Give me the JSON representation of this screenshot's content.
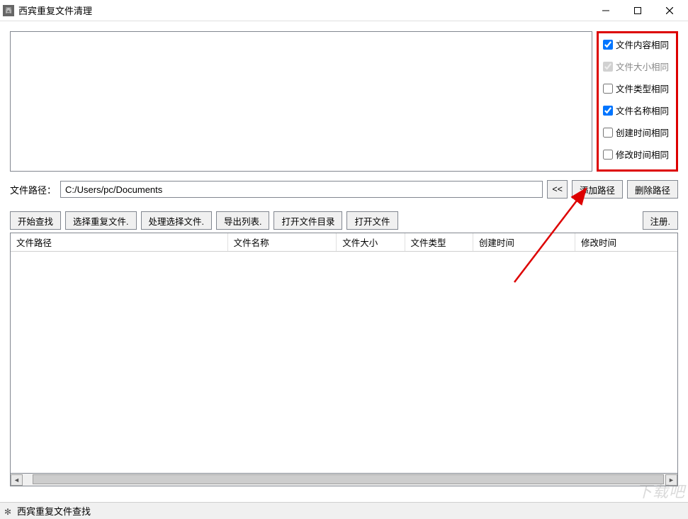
{
  "title": "西宾重复文件清理",
  "filters": [
    {
      "label": "文件内容相同",
      "checked": true,
      "disabled": false
    },
    {
      "label": "文件大小相同",
      "checked": true,
      "disabled": true
    },
    {
      "label": "文件类型相同",
      "checked": false,
      "disabled": false
    },
    {
      "label": "文件名称相同",
      "checked": true,
      "disabled": false
    },
    {
      "label": "创建时间相同",
      "checked": false,
      "disabled": false
    },
    {
      "label": "修改时间相同",
      "checked": false,
      "disabled": false
    }
  ],
  "path_row": {
    "label": "文件路径：",
    "value": "C:/Users/pc/Documents",
    "history_btn": "<<",
    "add_btn": "添加路径",
    "del_btn": "删除路径"
  },
  "toolbar": {
    "start": "开始查找",
    "select_dup": "选择重复文件.",
    "process_sel": "处理选择文件.",
    "export": "导出列表.",
    "open_dir": "打开文件目录",
    "open_file": "打开文件",
    "register": "注册."
  },
  "columns": {
    "c0": "文件路径",
    "c1": "文件名称",
    "c2": "文件大小",
    "c3": "文件类型",
    "c4": "创建时间",
    "c5": "修改时间"
  },
  "status": "西宾重复文件查找",
  "watermark": "下载吧"
}
